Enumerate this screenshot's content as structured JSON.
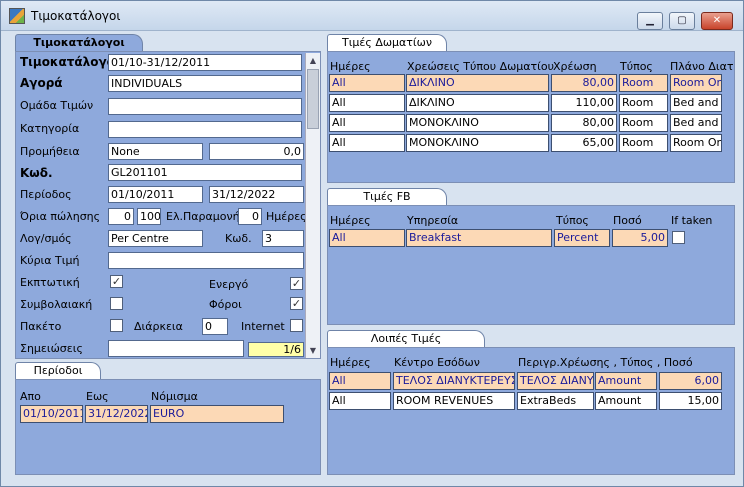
{
  "window": {
    "title": "Τιμοκατάλογοι"
  },
  "left": {
    "tab": "Τιμοκατάλογοι",
    "fields": {
      "pricelist_label": "Τιμοκατάλογος",
      "pricelist_value": "01/10-31/12/2011",
      "market_label": "Αγορά",
      "market_value": "INDIVIDUALS",
      "price_group_label": "Ομάδα Τιμών",
      "category_label": "Κατηγορία",
      "commission_label": "Προμήθεια",
      "commission_type": "None",
      "commission_value": "0,0",
      "code_label": "Κωδ.",
      "code_value": "GL201101",
      "period_label": "Περίοδος",
      "period_from": "01/10/2011",
      "period_to": "31/12/2022",
      "sales_limits_label": "Όρια πώλησης",
      "sales_min": "0",
      "sales_max": "100",
      "min_stay_label": "Ελ.Παραμονή",
      "min_stay_value": "0",
      "days_label": "Ημέρες",
      "account_label": "Λογ/σμός",
      "account_value": "Per Centre",
      "account_code_label": "Κωδ.",
      "account_code_value": "3",
      "main_price_label": "Κύρια Τιμή",
      "discount_label": "Εκπτωτική",
      "active_label": "Ενεργό",
      "contract_label": "Συμβολαιακή",
      "taxes_label": "Φόροι",
      "package_label": "Πακέτο",
      "duration_label": "Διάρκεια",
      "duration_value": "0",
      "internet_label": "Internet",
      "notes_label": "Σημειώσεις",
      "record_counter": "1/6"
    },
    "checks": {
      "discount": "✓",
      "active": "✓",
      "contract": "",
      "taxes": "✓",
      "package": "",
      "internet": ""
    }
  },
  "periods": {
    "tab": "Περίοδοι",
    "headers": [
      "Απο",
      "Εως",
      "Νόμισμα"
    ],
    "rows": [
      [
        "01/10/2011",
        "31/12/2022",
        "EURO"
      ]
    ]
  },
  "room_prices": {
    "tab": "Τιμές Δωματίων",
    "headers": [
      "Ημέρες",
      "Χρεώσεις Τύπου Δωματίου",
      "Χρέωση",
      "Τύπος",
      "Πλάνο Διατ"
    ],
    "rows": [
      [
        "All",
        "ΔΙΚΛΙΝΟ",
        "80,00",
        "Room",
        "Room Only"
      ],
      [
        "All",
        "ΔΙΚΛΙΝΟ",
        "110,00",
        "Room",
        "Bed and Br"
      ],
      [
        "All",
        "ΜΟΝΟΚΛΙΝΟ",
        "80,00",
        "Room",
        "Bed and Br"
      ],
      [
        "All",
        "ΜΟΝΟΚΛΙΝΟ",
        "65,00",
        "Room",
        "Room Only"
      ]
    ]
  },
  "fb_prices": {
    "tab": "Τιμές FB",
    "headers": [
      "Ημέρες",
      "Υπηρεσία",
      "Τύπος",
      "Ποσό",
      "If taken"
    ],
    "rows": [
      [
        "All",
        "Breakfast",
        "Percent",
        "5,00",
        ""
      ]
    ]
  },
  "other_prices": {
    "tab": "Λοιπές Τιμές",
    "headers": [
      "Ημέρες",
      "Κέντρο Εσόδων",
      "Περιγρ.Χρέωσης , Τύπος , Ποσό"
    ],
    "rows": [
      [
        "All",
        "ΤΕΛΟΣ ΔΙΑΝΥΚΤΕΡΕΥΣΗΣ",
        "ΤΕΛΟΣ ΔΙΑΝΥΚ",
        "Amount",
        "6,00"
      ],
      [
        "All",
        "ROOM REVENUES",
        "ExtraBeds",
        "Amount",
        "15,00"
      ]
    ]
  }
}
